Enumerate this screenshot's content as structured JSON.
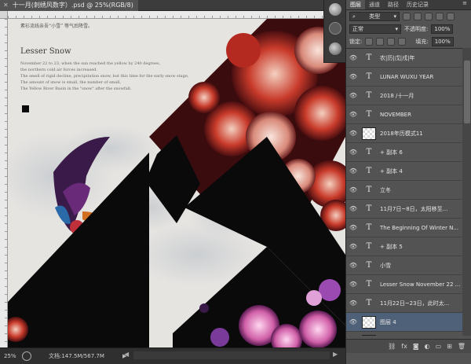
{
  "document": {
    "tab_title": "十一月(刺绣风数字）.psd @ 25%(RGB/8)",
    "zoom": "25%",
    "doc_size": "文档:147.5M/567.7M"
  },
  "poster": {
    "cn_header": "素衫流线亲吾“小雪” 等气后降雪。",
    "title": "Lesser Snow",
    "lines": [
      "November 22 to 23, when the sun reached the yellow by 240 degrees,",
      "the northern cold air forces increased.",
      "The smell of rigid decline, precipitation snow, but this time for the early snow stage,",
      "The amount of snow is small, the number of small,",
      "The Yellow River Basin in the \"snow\" after the snowfall."
    ]
  },
  "layers_panel": {
    "tabs": [
      "图层",
      "通道",
      "路径",
      "历史记录"
    ],
    "filter_label": "类型",
    "blend_mode": "正常",
    "opacity_label": "不透明度:",
    "opacity_value": "100%",
    "lock_label": "锁定:",
    "fill_label": "填充:",
    "fill_value": "100%",
    "layers": [
      {
        "name": "农|历|戊|戌|年",
        "kind": "text",
        "selected": false
      },
      {
        "name": "LUNAR WUXU YEAR",
        "kind": "text",
        "selected": false
      },
      {
        "name": "2018 /十一月",
        "kind": "text",
        "selected": false
      },
      {
        "name": "NOVEMBER",
        "kind": "text",
        "selected": false
      },
      {
        "name": "2018年历模式11",
        "kind": "pixel",
        "selected": false
      },
      {
        "name": "+ 副本 6",
        "kind": "text",
        "selected": false
      },
      {
        "name": "+ 副本 4",
        "kind": "text",
        "selected": false
      },
      {
        "name": "立冬",
        "kind": "text",
        "selected": false
      },
      {
        "name": "11月7日~8日，太阳移至...",
        "kind": "text",
        "selected": false
      },
      {
        "name": "The Beginning Of Winter N...",
        "kind": "text",
        "selected": false
      },
      {
        "name": "+ 副本 5",
        "kind": "text",
        "selected": false
      },
      {
        "name": "小雪",
        "kind": "text",
        "selected": false
      },
      {
        "name": "Lesser Snow November 22 ...",
        "kind": "text",
        "selected": false
      },
      {
        "name": "11月22日~23日，此时太...",
        "kind": "text",
        "selected": false
      },
      {
        "name": "图层 4",
        "kind": "pixel",
        "selected": true
      },
      {
        "name": "",
        "kind": "pixel",
        "selected": false
      }
    ]
  },
  "colors": {
    "selected_layer": "#4f6179",
    "panel_bg": "#535353",
    "black_shape": "#0a0a0a",
    "paper": "#e6e4e1"
  }
}
